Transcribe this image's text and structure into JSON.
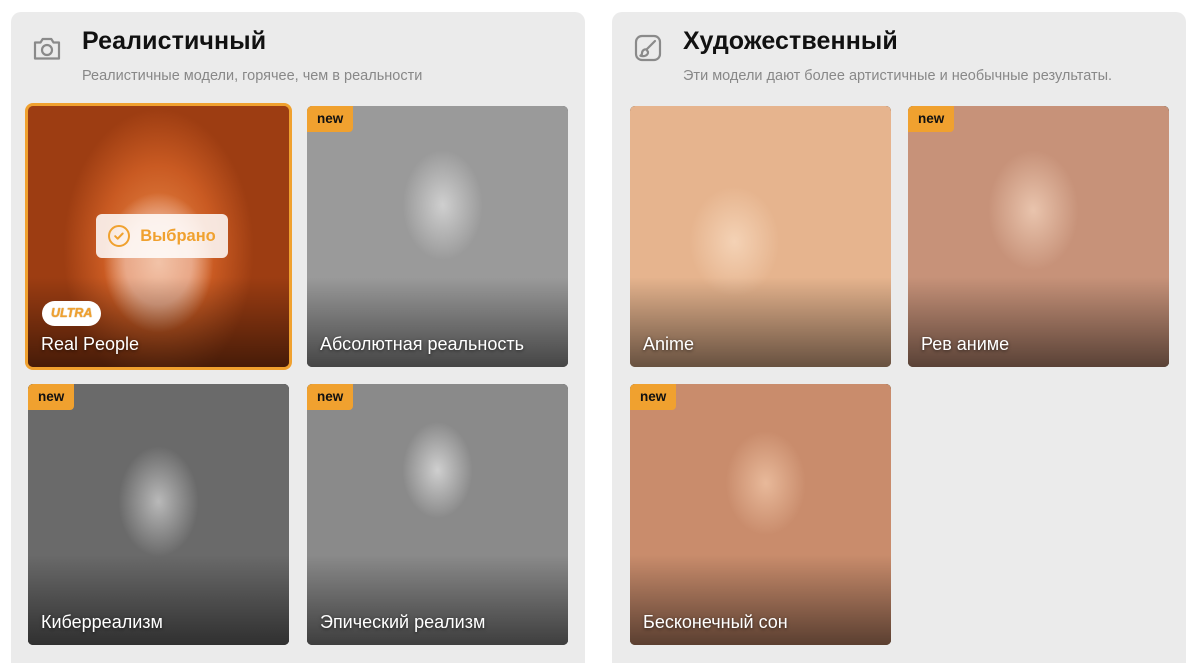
{
  "sections": [
    {
      "icon": "camera-icon",
      "title": "Реалистичный",
      "subtitle": "Реалистичные модели, горячее, чем в реальности",
      "cards": [
        {
          "label": "Real People",
          "badge": "ULTRA",
          "selected": true,
          "selected_text": "Выбрано"
        },
        {
          "label": "Абсолютная реальность",
          "badge": "new"
        },
        {
          "label": "Киберреализм",
          "badge": "new"
        },
        {
          "label": "Эпический реализм",
          "badge": "new"
        }
      ]
    },
    {
      "icon": "palette-brush-icon",
      "title": "Художественный",
      "subtitle": "Эти модели дают более артистичные и необычные результаты.",
      "cards": [
        {
          "label": "Anime"
        },
        {
          "label": "Рев аниме",
          "badge": "new"
        },
        {
          "label": "Бесконечный сон",
          "badge": "new"
        }
      ]
    }
  ],
  "colors": {
    "accent": "#f0a12f",
    "panel_bg": "#ebebeb",
    "title": "#111111",
    "subtitle": "#888888"
  }
}
